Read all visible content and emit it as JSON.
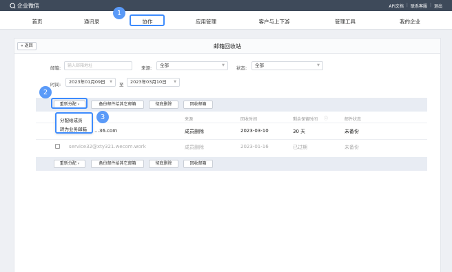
{
  "topbar": {
    "app_name": "企业微信",
    "links": [
      "API文档",
      "联系客服",
      "退出"
    ]
  },
  "nav": {
    "items": [
      "首页",
      "通讯录",
      "协作",
      "应用管理",
      "客户与上下游",
      "管理工具",
      "我的企业"
    ],
    "active": "协作"
  },
  "badges": [
    "1",
    "2",
    "3"
  ],
  "page": {
    "back_label": "« 返回",
    "title": "邮箱回收站"
  },
  "filters": {
    "email_label": "邮箱:",
    "email_placeholder": "输入邮箱地址",
    "source_label": "来源:",
    "source_value": "全部",
    "status_label": "状态:",
    "status_value": "全部",
    "time_label": "时间:",
    "date_from": "2023年01月09日",
    "date_sep": "至",
    "date_to": "2023年03月10日"
  },
  "toolbar": {
    "reassign": "重新分配",
    "backup": "备份邮件给其它邮箱",
    "delete": "彻底删除",
    "recover": "回收邮箱"
  },
  "dropdown": {
    "options": [
      "分配给成员",
      "转为业务邮箱"
    ]
  },
  "table": {
    "headers": [
      "来源",
      "回收时间",
      "剩余保留时间",
      "邮件状态"
    ],
    "rows": [
      {
        "email": "…36.com",
        "source": "成员删除",
        "time": "2023-03-10",
        "remaining": "30 天",
        "status": "未备份",
        "muted": false
      },
      {
        "email": "service32@xty321.wecom.work",
        "source": "成员删除",
        "time": "2023-01-16",
        "remaining": "已过期",
        "status": "未备份",
        "muted": true
      }
    ]
  },
  "colors": {
    "highlight": "#3d8bfd",
    "badge": "#5a9af8",
    "topbar": "#3e4a5a"
  }
}
